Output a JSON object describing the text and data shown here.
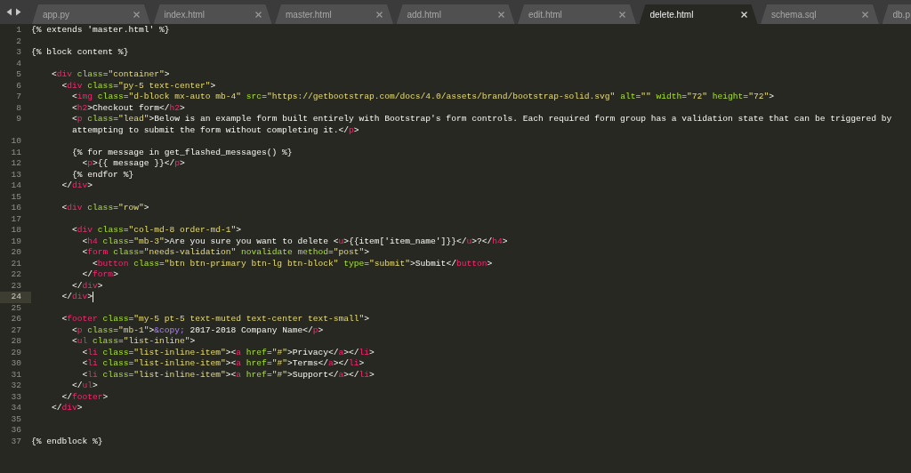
{
  "tabs": [
    {
      "label": "app.py",
      "selected": false,
      "closable": true
    },
    {
      "label": "index.html",
      "selected": false,
      "closable": true
    },
    {
      "label": "master.html",
      "selected": false,
      "closable": true
    },
    {
      "label": "add.html",
      "selected": false,
      "closable": true
    },
    {
      "label": "edit.html",
      "selected": false,
      "closable": true
    },
    {
      "label": "delete.html",
      "selected": true,
      "closable": true
    },
    {
      "label": "schema.sql",
      "selected": false,
      "closable": true
    },
    {
      "label": "db.p",
      "selected": false,
      "closable": false
    }
  ],
  "editor": {
    "lines": [
      {
        "number": "1",
        "current": false,
        "tokens": [
          {
            "kind": "plain",
            "text": "{% extends 'master.html' %}"
          }
        ]
      },
      {
        "number": "2",
        "current": false
      },
      {
        "number": "3",
        "current": false,
        "tokens": [
          {
            "kind": "plain",
            "text": "{% block content %}"
          }
        ]
      },
      {
        "number": "4",
        "current": false
      },
      {
        "number": "5",
        "current": false,
        "tokens": [
          {
            "kind": "plain",
            "text": "    <"
          },
          {
            "kind": "tag",
            "text": "div"
          },
          {
            "kind": "attr",
            "text": " class"
          },
          {
            "kind": "plain",
            "text": "="
          },
          {
            "kind": "string",
            "text": "\"container\""
          },
          {
            "kind": "plain",
            "text": ">"
          }
        ]
      },
      {
        "number": "6",
        "current": false,
        "tokens": [
          {
            "kind": "plain",
            "text": "      <"
          },
          {
            "kind": "tag",
            "text": "div"
          },
          {
            "kind": "attr",
            "text": " class"
          },
          {
            "kind": "plain",
            "text": "="
          },
          {
            "kind": "string",
            "text": "\"py-5 text-center\""
          },
          {
            "kind": "plain",
            "text": ">"
          }
        ]
      },
      {
        "number": "7",
        "current": false,
        "tokens": [
          {
            "kind": "plain",
            "text": "        <"
          },
          {
            "kind": "tag",
            "text": "img"
          },
          {
            "kind": "attr",
            "text": " class"
          },
          {
            "kind": "plain",
            "text": "="
          },
          {
            "kind": "string",
            "text": "\"d-block mx-auto mb-4\""
          },
          {
            "kind": "attr",
            "text": " src"
          },
          {
            "kind": "plain",
            "text": "="
          },
          {
            "kind": "string",
            "text": "\"https://getbootstrap.com/docs/4.0/assets/brand/bootstrap-solid.svg\""
          },
          {
            "kind": "attr",
            "text": " alt"
          },
          {
            "kind": "plain",
            "text": "="
          },
          {
            "kind": "string",
            "text": "\"\""
          },
          {
            "kind": "attr",
            "text": " width"
          },
          {
            "kind": "plain",
            "text": "="
          },
          {
            "kind": "string",
            "text": "\"72\""
          },
          {
            "kind": "attr",
            "text": " height"
          },
          {
            "kind": "plain",
            "text": "="
          },
          {
            "kind": "string",
            "text": "\"72\""
          },
          {
            "kind": "plain",
            "text": ">"
          }
        ]
      },
      {
        "number": "8",
        "current": false,
        "tokens": [
          {
            "kind": "plain",
            "text": "        <"
          },
          {
            "kind": "tag",
            "text": "h2"
          },
          {
            "kind": "plain",
            "text": ">Checkout form</"
          },
          {
            "kind": "tag",
            "text": "h2"
          },
          {
            "kind": "plain",
            "text": ">"
          }
        ]
      },
      {
        "number": "9",
        "current": false,
        "tokens": [
          {
            "kind": "plain",
            "text": "        <"
          },
          {
            "kind": "tag",
            "text": "p"
          },
          {
            "kind": "attr",
            "text": " class"
          },
          {
            "kind": "plain",
            "text": "="
          },
          {
            "kind": "string",
            "text": "\"lead\""
          },
          {
            "kind": "plain",
            "text": ">Below is an example form built entirely with Bootstrap's form controls. Each required form group has a validation state that can be triggered by"
          }
        ],
        "wrap": [
          {
            "kind": "plain",
            "text": "        attempting to submit the form without completing it.</"
          },
          {
            "kind": "tag",
            "text": "p"
          },
          {
            "kind": "plain",
            "text": ">"
          }
        ]
      },
      {
        "number": "10",
        "current": false
      },
      {
        "number": "11",
        "current": false,
        "tokens": [
          {
            "kind": "plain",
            "text": "        {% for message in get_flashed_messages() %}"
          }
        ]
      },
      {
        "number": "12",
        "current": false,
        "tokens": [
          {
            "kind": "plain",
            "text": "          <"
          },
          {
            "kind": "tag",
            "text": "p"
          },
          {
            "kind": "plain",
            "text": ">{{ message }}</"
          },
          {
            "kind": "tag",
            "text": "p"
          },
          {
            "kind": "plain",
            "text": ">"
          }
        ]
      },
      {
        "number": "13",
        "current": false,
        "tokens": [
          {
            "kind": "plain",
            "text": "        {% endfor %}"
          }
        ]
      },
      {
        "number": "14",
        "current": false,
        "tokens": [
          {
            "kind": "plain",
            "text": "      </"
          },
          {
            "kind": "tag",
            "text": "div"
          },
          {
            "kind": "plain",
            "text": ">"
          }
        ]
      },
      {
        "number": "15",
        "current": false
      },
      {
        "number": "16",
        "current": false,
        "tokens": [
          {
            "kind": "plain",
            "text": "      <"
          },
          {
            "kind": "tag",
            "text": "div"
          },
          {
            "kind": "attr",
            "text": " class"
          },
          {
            "kind": "plain",
            "text": "="
          },
          {
            "kind": "string",
            "text": "\"row\""
          },
          {
            "kind": "plain",
            "text": ">"
          }
        ]
      },
      {
        "number": "17",
        "current": false
      },
      {
        "number": "18",
        "current": false,
        "tokens": [
          {
            "kind": "plain",
            "text": "        <"
          },
          {
            "kind": "tag",
            "text": "div"
          },
          {
            "kind": "attr",
            "text": " class"
          },
          {
            "kind": "plain",
            "text": "="
          },
          {
            "kind": "string",
            "text": "\"col-md-8 order-md-1\""
          },
          {
            "kind": "plain",
            "text": ">"
          }
        ]
      },
      {
        "number": "19",
        "current": false,
        "tokens": [
          {
            "kind": "plain",
            "text": "          <"
          },
          {
            "kind": "tag",
            "text": "h4"
          },
          {
            "kind": "attr",
            "text": " class"
          },
          {
            "kind": "plain",
            "text": "="
          },
          {
            "kind": "string",
            "text": "\"mb-3\""
          },
          {
            "kind": "plain",
            "text": ">Are you sure you want to delete <"
          },
          {
            "kind": "tag",
            "text": "u"
          },
          {
            "kind": "plain",
            "text": ">{{item['item_name']}}</"
          },
          {
            "kind": "tag",
            "text": "u"
          },
          {
            "kind": "plain",
            "text": ">?</"
          },
          {
            "kind": "tag",
            "text": "h4"
          },
          {
            "kind": "plain",
            "text": ">"
          }
        ]
      },
      {
        "number": "20",
        "current": false,
        "tokens": [
          {
            "kind": "plain",
            "text": "          <"
          },
          {
            "kind": "tag",
            "text": "form"
          },
          {
            "kind": "attr",
            "text": " class"
          },
          {
            "kind": "plain",
            "text": "="
          },
          {
            "kind": "string",
            "text": "\"needs-validation\""
          },
          {
            "kind": "attr",
            "text": " novalidate method"
          },
          {
            "kind": "plain",
            "text": "="
          },
          {
            "kind": "string",
            "text": "\"post\""
          },
          {
            "kind": "plain",
            "text": ">"
          }
        ]
      },
      {
        "number": "21",
        "current": false,
        "tokens": [
          {
            "kind": "plain",
            "text": "            <"
          },
          {
            "kind": "tag",
            "text": "button"
          },
          {
            "kind": "attr",
            "text": " class"
          },
          {
            "kind": "plain",
            "text": "="
          },
          {
            "kind": "string",
            "text": "\"btn btn-primary btn-lg btn-block\""
          },
          {
            "kind": "attr",
            "text": " type"
          },
          {
            "kind": "plain",
            "text": "="
          },
          {
            "kind": "string",
            "text": "\"submit\""
          },
          {
            "kind": "plain",
            "text": ">Submit</"
          },
          {
            "kind": "tag",
            "text": "button"
          },
          {
            "kind": "plain",
            "text": ">"
          }
        ]
      },
      {
        "number": "22",
        "current": false,
        "tokens": [
          {
            "kind": "plain",
            "text": "          </"
          },
          {
            "kind": "tag",
            "text": "form"
          },
          {
            "kind": "plain",
            "text": ">"
          }
        ]
      },
      {
        "number": "23",
        "current": false,
        "tokens": [
          {
            "kind": "plain",
            "text": "        </"
          },
          {
            "kind": "tag",
            "text": "div"
          },
          {
            "kind": "plain",
            "text": ">"
          }
        ]
      },
      {
        "number": "24",
        "current": true,
        "tokens": [
          {
            "kind": "plain",
            "text": "      </"
          },
          {
            "kind": "tag",
            "text": "div"
          },
          {
            "kind": "plain",
            "text": ">"
          }
        ]
      },
      {
        "number": "25",
        "current": false
      },
      {
        "number": "26",
        "current": false,
        "tokens": [
          {
            "kind": "plain",
            "text": "      <"
          },
          {
            "kind": "tag",
            "text": "footer"
          },
          {
            "kind": "attr",
            "text": " class"
          },
          {
            "kind": "plain",
            "text": "="
          },
          {
            "kind": "string",
            "text": "\"my-5 pt-5 text-muted text-center text-small\""
          },
          {
            "kind": "plain",
            "text": ">"
          }
        ]
      },
      {
        "number": "27",
        "current": false,
        "tokens": [
          {
            "kind": "plain",
            "text": "        <"
          },
          {
            "kind": "tag",
            "text": "p"
          },
          {
            "kind": "attr",
            "text": " class"
          },
          {
            "kind": "plain",
            "text": "="
          },
          {
            "kind": "string",
            "text": "\"mb-1\""
          },
          {
            "kind": "plain",
            "text": ">"
          },
          {
            "kind": "entity",
            "text": "&copy;"
          },
          {
            "kind": "plain",
            "text": " 2017-2018 Company Name</"
          },
          {
            "kind": "tag",
            "text": "p"
          },
          {
            "kind": "plain",
            "text": ">"
          }
        ]
      },
      {
        "number": "28",
        "current": false,
        "tokens": [
          {
            "kind": "plain",
            "text": "        <"
          },
          {
            "kind": "tag",
            "text": "ul"
          },
          {
            "kind": "attr",
            "text": " class"
          },
          {
            "kind": "plain",
            "text": "="
          },
          {
            "kind": "string",
            "text": "\"list-inline\""
          },
          {
            "kind": "plain",
            "text": ">"
          }
        ]
      },
      {
        "number": "29",
        "current": false,
        "tokens": [
          {
            "kind": "plain",
            "text": "          <"
          },
          {
            "kind": "tag",
            "text": "li"
          },
          {
            "kind": "attr",
            "text": " class"
          },
          {
            "kind": "plain",
            "text": "="
          },
          {
            "kind": "string",
            "text": "\"list-inline-item\""
          },
          {
            "kind": "plain",
            "text": "><"
          },
          {
            "kind": "tag",
            "text": "a"
          },
          {
            "kind": "attr",
            "text": " href"
          },
          {
            "kind": "plain",
            "text": "="
          },
          {
            "kind": "string",
            "text": "\"#\""
          },
          {
            "kind": "plain",
            "text": ">Privacy</"
          },
          {
            "kind": "tag",
            "text": "a"
          },
          {
            "kind": "plain",
            "text": "></"
          },
          {
            "kind": "tag",
            "text": "li"
          },
          {
            "kind": "plain",
            "text": ">"
          }
        ]
      },
      {
        "number": "30",
        "current": false,
        "tokens": [
          {
            "kind": "plain",
            "text": "          <"
          },
          {
            "kind": "tag",
            "text": "li"
          },
          {
            "kind": "attr",
            "text": " class"
          },
          {
            "kind": "plain",
            "text": "="
          },
          {
            "kind": "string",
            "text": "\"list-inline-item\""
          },
          {
            "kind": "plain",
            "text": "><"
          },
          {
            "kind": "tag",
            "text": "a"
          },
          {
            "kind": "attr",
            "text": " href"
          },
          {
            "kind": "plain",
            "text": "="
          },
          {
            "kind": "string",
            "text": "\"#\""
          },
          {
            "kind": "plain",
            "text": ">Terms</"
          },
          {
            "kind": "tag",
            "text": "a"
          },
          {
            "kind": "plain",
            "text": "></"
          },
          {
            "kind": "tag",
            "text": "li"
          },
          {
            "kind": "plain",
            "text": ">"
          }
        ]
      },
      {
        "number": "31",
        "current": false,
        "tokens": [
          {
            "kind": "plain",
            "text": "          <"
          },
          {
            "kind": "tag",
            "text": "li"
          },
          {
            "kind": "attr",
            "text": " class"
          },
          {
            "kind": "plain",
            "text": "="
          },
          {
            "kind": "string",
            "text": "\"list-inline-item\""
          },
          {
            "kind": "plain",
            "text": "><"
          },
          {
            "kind": "tag",
            "text": "a"
          },
          {
            "kind": "attr",
            "text": " href"
          },
          {
            "kind": "plain",
            "text": "="
          },
          {
            "kind": "string",
            "text": "\"#\""
          },
          {
            "kind": "plain",
            "text": ">Support</"
          },
          {
            "kind": "tag",
            "text": "a"
          },
          {
            "kind": "plain",
            "text": "></"
          },
          {
            "kind": "tag",
            "text": "li"
          },
          {
            "kind": "plain",
            "text": ">"
          }
        ]
      },
      {
        "number": "32",
        "current": false,
        "tokens": [
          {
            "kind": "plain",
            "text": "        </"
          },
          {
            "kind": "tag",
            "text": "ul"
          },
          {
            "kind": "plain",
            "text": ">"
          }
        ]
      },
      {
        "number": "33",
        "current": false,
        "tokens": [
          {
            "kind": "plain",
            "text": "      </"
          },
          {
            "kind": "tag",
            "text": "footer"
          },
          {
            "kind": "plain",
            "text": ">"
          }
        ]
      },
      {
        "number": "34",
        "current": false,
        "tokens": [
          {
            "kind": "plain",
            "text": "    </"
          },
          {
            "kind": "tag",
            "text": "div"
          },
          {
            "kind": "plain",
            "text": ">"
          }
        ]
      },
      {
        "number": "35",
        "current": false
      },
      {
        "number": "36",
        "current": false
      },
      {
        "number": "37",
        "current": false,
        "tokens": [
          {
            "kind": "plain",
            "text": "{% endblock %}"
          }
        ]
      }
    ]
  }
}
